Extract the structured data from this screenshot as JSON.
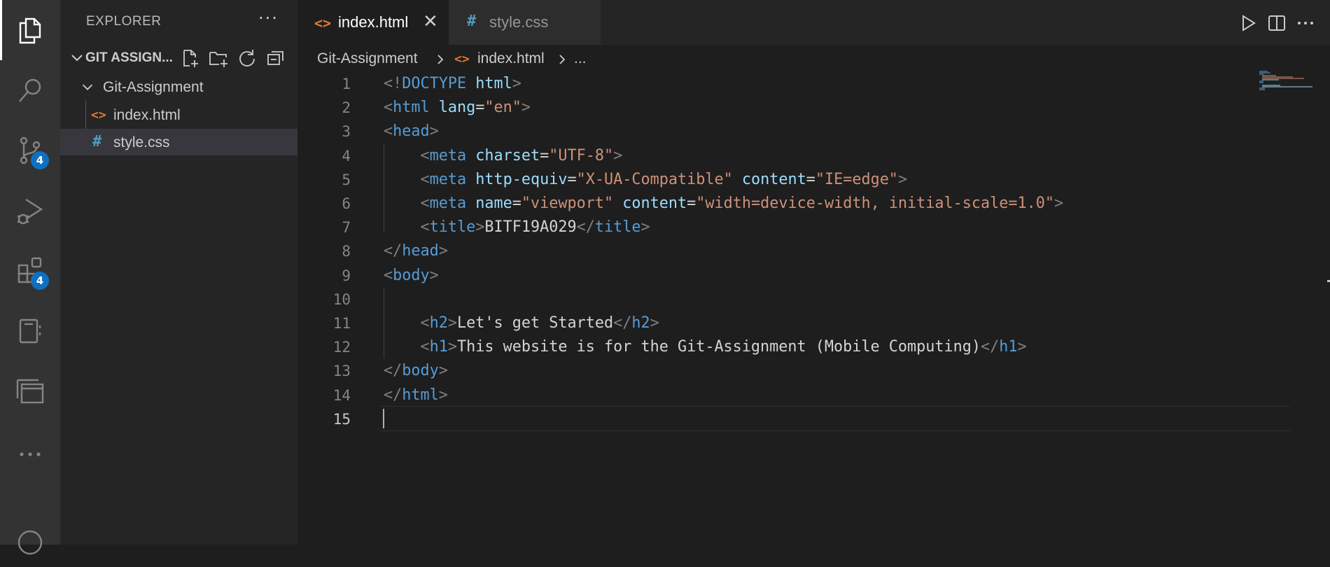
{
  "activity_bar": {
    "items": [
      {
        "name": "explorer-icon",
        "active": true
      },
      {
        "name": "search-icon"
      },
      {
        "name": "source-control-icon",
        "badge": "4"
      },
      {
        "name": "run-debug-icon"
      },
      {
        "name": "extensions-icon",
        "badge": "4"
      },
      {
        "name": "notebook-icon"
      },
      {
        "name": "remote-explorer-icon"
      },
      {
        "name": "more-icon"
      }
    ]
  },
  "sidebar": {
    "title": "EXPLORER",
    "section_label": "GIT ASSIGN...",
    "tree": [
      {
        "label": "Git-Assignment",
        "type": "folder"
      },
      {
        "label": "index.html",
        "type": "html"
      },
      {
        "label": "style.css",
        "type": "css",
        "selected": true
      }
    ]
  },
  "tabs": [
    {
      "label": "index.html",
      "icon": "<>",
      "active": true
    },
    {
      "label": "style.css",
      "icon": "#",
      "active": false
    }
  ],
  "breadcrumb": {
    "folder": "Git-Assignment",
    "file_icon": "<>",
    "file": "index.html",
    "more": "..."
  },
  "editor": {
    "current_line": 15,
    "lines": [
      {
        "n": "1",
        "tokens": [
          [
            "punc",
            "<!"
          ],
          [
            "tag",
            "DOCTYPE"
          ],
          [
            "text",
            " "
          ],
          [
            "attr",
            "html"
          ],
          [
            "punc",
            ">"
          ]
        ]
      },
      {
        "n": "2",
        "tokens": [
          [
            "punc",
            "<"
          ],
          [
            "tag",
            "html"
          ],
          [
            "text",
            " "
          ],
          [
            "attr",
            "lang"
          ],
          [
            "text",
            "="
          ],
          [
            "str",
            "\"en\""
          ],
          [
            "punc",
            ">"
          ]
        ]
      },
      {
        "n": "3",
        "tokens": [
          [
            "punc",
            "<"
          ],
          [
            "tag",
            "head"
          ],
          [
            "punc",
            ">"
          ]
        ]
      },
      {
        "n": "4",
        "tokens": [
          [
            "text",
            "    "
          ],
          [
            "punc",
            "<"
          ],
          [
            "tag",
            "meta"
          ],
          [
            "text",
            " "
          ],
          [
            "attr",
            "charset"
          ],
          [
            "text",
            "="
          ],
          [
            "str",
            "\"UTF-8\""
          ],
          [
            "punc",
            ">"
          ]
        ]
      },
      {
        "n": "5",
        "tokens": [
          [
            "text",
            "    "
          ],
          [
            "punc",
            "<"
          ],
          [
            "tag",
            "meta"
          ],
          [
            "text",
            " "
          ],
          [
            "attr",
            "http-equiv"
          ],
          [
            "text",
            "="
          ],
          [
            "str",
            "\"X-UA-Compatible\""
          ],
          [
            "text",
            " "
          ],
          [
            "attr",
            "content"
          ],
          [
            "text",
            "="
          ],
          [
            "str",
            "\"IE=edge\""
          ],
          [
            "punc",
            ">"
          ]
        ]
      },
      {
        "n": "6",
        "tokens": [
          [
            "text",
            "    "
          ],
          [
            "punc",
            "<"
          ],
          [
            "tag",
            "meta"
          ],
          [
            "text",
            " "
          ],
          [
            "attr",
            "name"
          ],
          [
            "text",
            "="
          ],
          [
            "str",
            "\"viewport\""
          ],
          [
            "text",
            " "
          ],
          [
            "attr",
            "content"
          ],
          [
            "text",
            "="
          ],
          [
            "str",
            "\"width=device-width, initial-scale=1.0\""
          ],
          [
            "punc",
            ">"
          ]
        ]
      },
      {
        "n": "7",
        "tokens": [
          [
            "text",
            "    "
          ],
          [
            "punc",
            "<"
          ],
          [
            "tag",
            "title"
          ],
          [
            "punc",
            ">"
          ],
          [
            "text",
            "BITF19A029"
          ],
          [
            "punc",
            "</"
          ],
          [
            "tag",
            "title"
          ],
          [
            "punc",
            ">"
          ]
        ]
      },
      {
        "n": "8",
        "tokens": [
          [
            "punc",
            "</"
          ],
          [
            "tag",
            "head"
          ],
          [
            "punc",
            ">"
          ]
        ]
      },
      {
        "n": "9",
        "tokens": [
          [
            "punc",
            "<"
          ],
          [
            "tag",
            "body"
          ],
          [
            "punc",
            ">"
          ]
        ]
      },
      {
        "n": "10",
        "tokens": []
      },
      {
        "n": "11",
        "tokens": [
          [
            "text",
            "    "
          ],
          [
            "punc",
            "<"
          ],
          [
            "tag",
            "h2"
          ],
          [
            "punc",
            ">"
          ],
          [
            "text",
            "Let's get Started"
          ],
          [
            "punc",
            "</"
          ],
          [
            "tag",
            "h2"
          ],
          [
            "punc",
            ">"
          ]
        ]
      },
      {
        "n": "12",
        "tokens": [
          [
            "text",
            "    "
          ],
          [
            "punc",
            "<"
          ],
          [
            "tag",
            "h1"
          ],
          [
            "punc",
            ">"
          ],
          [
            "text",
            "This website is for the Git-Assignment (Mobile Computing)"
          ],
          [
            "punc",
            "</"
          ],
          [
            "tag",
            "h1"
          ],
          [
            "punc",
            ">"
          ]
        ]
      },
      {
        "n": "13",
        "tokens": [
          [
            "punc",
            "</"
          ],
          [
            "tag",
            "body"
          ],
          [
            "punc",
            ">"
          ]
        ]
      },
      {
        "n": "14",
        "tokens": [
          [
            "punc",
            "</"
          ],
          [
            "tag",
            "html"
          ],
          [
            "punc",
            ">"
          ]
        ]
      },
      {
        "n": "15",
        "tokens": []
      }
    ]
  },
  "colors": {
    "accent_badge": "#0e70c0",
    "html_icon": "#e37933",
    "css_icon": "#519aba"
  }
}
